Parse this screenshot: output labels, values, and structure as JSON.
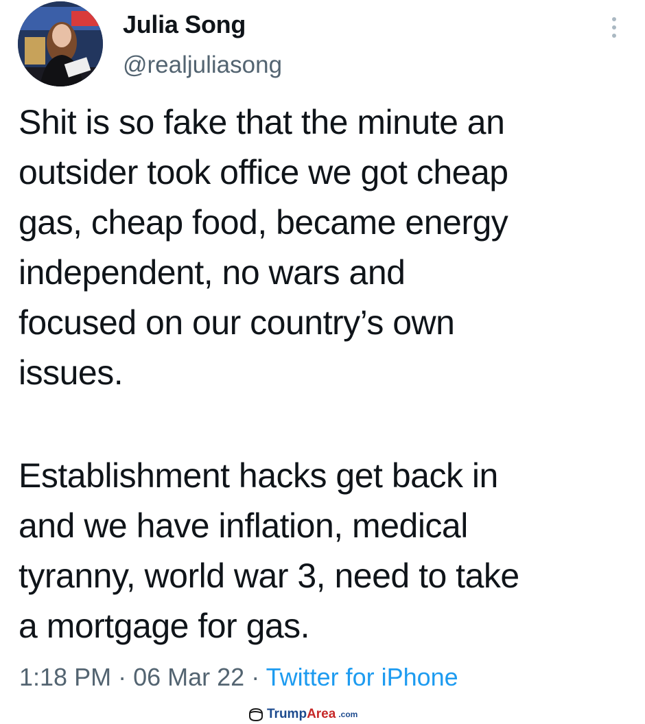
{
  "tweet": {
    "author_name": "Julia Song",
    "author_handle": "@realjuliasong",
    "text_paragraph_1": "Shit is so fake that the minute an\noutsider took office we got cheap\ngas, cheap food, became energy\nindependent, no wars and\nfocused on our country’s own\nissues.",
    "text_paragraph_2": "Establishment hacks get back in\nand we have inflation, medical\ntyranny, world war 3, need to take\na mortgage for gas.",
    "time": "1:18 PM",
    "separator": "·",
    "date": "06 Mar 22",
    "source": "Twitter for iPhone"
  },
  "icons": {
    "more": "more-vertical-icon",
    "watermark_logo": "trump-hair-logo-icon"
  },
  "watermark": {
    "brand_part_1": "Trump",
    "brand_part_2": "Area",
    "suffix": ".com"
  },
  "colors": {
    "text": "#0f1419",
    "secondary_text": "#536471",
    "link": "#1d9bf0",
    "watermark_blue": "#1c4a8e",
    "watermark_red": "#c62828"
  }
}
